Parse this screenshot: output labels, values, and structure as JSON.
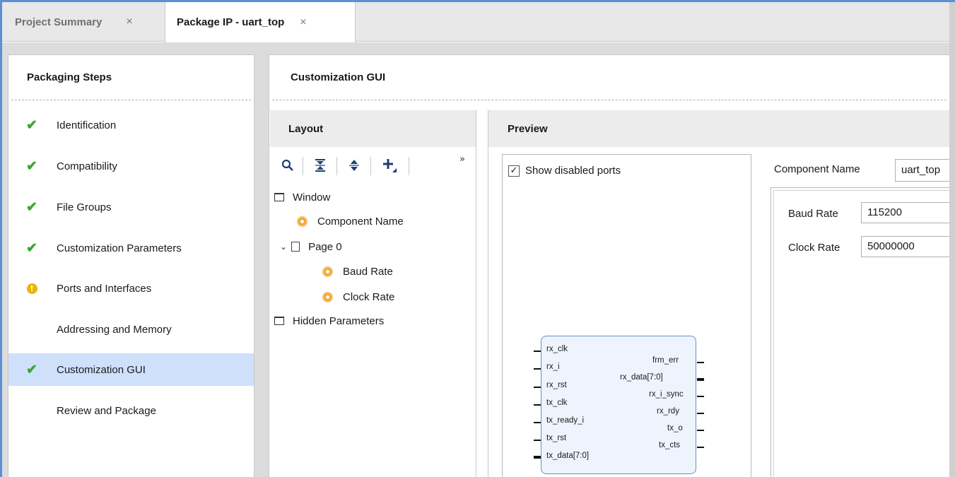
{
  "tabs": [
    {
      "label": "Project Summary",
      "close": "×"
    },
    {
      "label": "Package IP - uart_top",
      "close": "×"
    }
  ],
  "packaging": {
    "title": "Packaging Steps",
    "steps": [
      {
        "label": "Identification",
        "status": "check"
      },
      {
        "label": "Compatibility",
        "status": "check"
      },
      {
        "label": "File Groups",
        "status": "check"
      },
      {
        "label": "Customization Parameters",
        "status": "check"
      },
      {
        "label": "Ports and Interfaces",
        "status": "warning"
      },
      {
        "label": "Addressing and Memory",
        "status": "none"
      },
      {
        "label": "Customization GUI",
        "status": "check",
        "selected": true
      },
      {
        "label": "Review and Package",
        "status": "none"
      }
    ]
  },
  "main": {
    "title": "Customization GUI",
    "layout": {
      "title": "Layout",
      "toolbar": [
        "search-icon",
        "collapse-all-icon",
        "expand-all-icon",
        "add-icon"
      ],
      "more": "»",
      "tree": {
        "window": "Window",
        "component_name": "Component Name",
        "page0": "Page 0",
        "baud_rate": "Baud Rate",
        "clock_rate": "Clock Rate",
        "hidden": "Hidden Parameters"
      }
    },
    "preview": {
      "title": "Preview",
      "show_disabled_ports": "Show disabled ports",
      "show_disabled_checked": true,
      "ports_left": [
        "rx_clk",
        "rx_i",
        "rx_rst",
        "tx_clk",
        "tx_ready_i",
        "tx_rst",
        "tx_data[7:0]"
      ],
      "ports_right": [
        "frm_err",
        "rx_data[7:0]",
        "rx_i_sync",
        "rx_rdy",
        "tx_o",
        "tx_cts"
      ],
      "component_name_label": "Component Name",
      "component_name_value": "uart_top",
      "params": [
        {
          "label": "Baud Rate",
          "value": "115200"
        },
        {
          "label": "Clock Rate",
          "value": "50000000"
        }
      ]
    }
  },
  "colors": {
    "accent": "#5b8fd6",
    "selected_bg": "#cfe0fb",
    "check": "#3aa62e",
    "warning": "#f0b400"
  }
}
